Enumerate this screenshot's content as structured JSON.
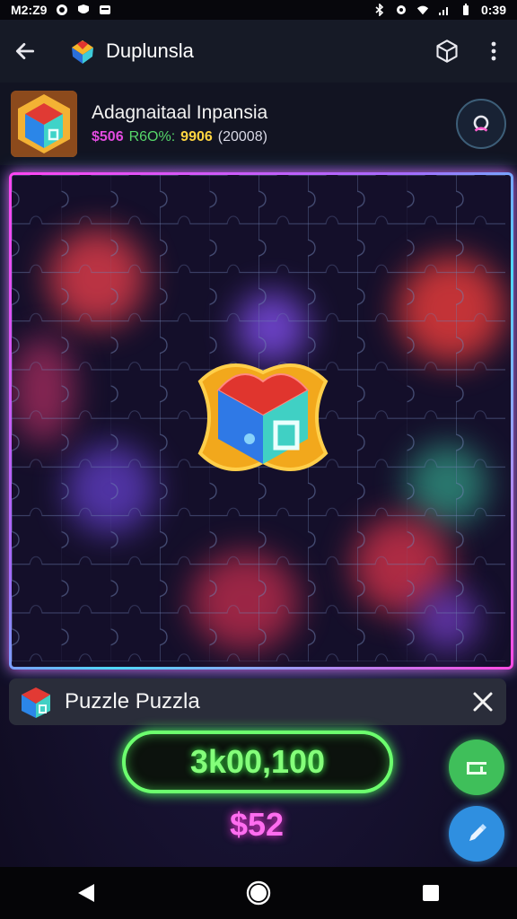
{
  "status_bar": {
    "time": "M2:Z9",
    "clock": "0:39"
  },
  "app_bar": {
    "title": "Duplunsla"
  },
  "header": {
    "title": "Adagnaitaal Inpansia",
    "stat_a": "$506",
    "stat_b": "R6O%:",
    "stat_c": "9906",
    "stat_d": "(20008)"
  },
  "banner": {
    "title": "Puzzle Puzzla"
  },
  "score": {
    "value": "3k00,100",
    "price": "$52"
  },
  "colors": {
    "accent_pink": "#ff45f2",
    "accent_cyan": "#4fd9ff",
    "score_green": "#84ff7a",
    "price_pink": "#ff6df0"
  },
  "icons": {
    "back": "arrow-left-icon",
    "cube": "cube-icon",
    "menu": "more-vert-icon",
    "search": "search-icon",
    "close": "close-icon",
    "fab_green": "layout-icon",
    "fab_blue": "pen-icon"
  }
}
